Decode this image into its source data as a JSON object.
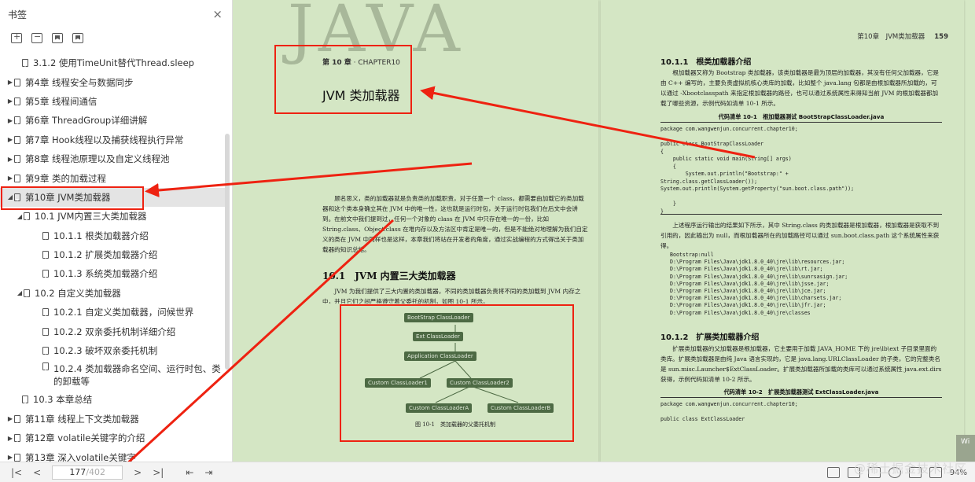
{
  "sidebar": {
    "title": "书签",
    "close": "×",
    "toc": [
      {
        "label": "3.1.2 使用TimeUnit替代Thread.sleep",
        "level": 1,
        "arrow": ""
      },
      {
        "label": "第4章 线程安全与数据同步",
        "level": 0,
        "arrow": "▶"
      },
      {
        "label": "第5章 线程间通信",
        "level": 0,
        "arrow": "▶"
      },
      {
        "label": "第6章 ThreadGroup详细讲解",
        "level": 0,
        "arrow": "▶"
      },
      {
        "label": "第7章 Hook线程以及捕获线程执行异常",
        "level": 0,
        "arrow": "▶"
      },
      {
        "label": "第8章 线程池原理以及自定义线程池",
        "level": 0,
        "arrow": "▶"
      },
      {
        "label": "第9章 类的加载过程",
        "level": 0,
        "arrow": "▶"
      },
      {
        "label": "第10章 JVM类加载器",
        "level": 0,
        "arrow": "◢",
        "selected": true
      },
      {
        "label": "10.1 JVM内置三大类加载器",
        "level": 1,
        "arrow": "◢"
      },
      {
        "label": "10.1.1 根类加载器介绍",
        "level": 2,
        "arrow": ""
      },
      {
        "label": "10.1.2 扩展类加载器介绍",
        "level": 2,
        "arrow": ""
      },
      {
        "label": "10.1.3 系统类加载器介绍",
        "level": 2,
        "arrow": ""
      },
      {
        "label": "10.2 自定义类加载器",
        "level": 1,
        "arrow": "◢"
      },
      {
        "label": "10.2.1 自定义类加载器，问候世界",
        "level": 2,
        "arrow": ""
      },
      {
        "label": "10.2.2 双亲委托机制详细介绍",
        "level": 2,
        "arrow": ""
      },
      {
        "label": "10.2.3 破坏双亲委托机制",
        "level": 2,
        "arrow": ""
      },
      {
        "label": "10.2.4 类加载器命名空间、运行时包、类的卸载等",
        "level": 2,
        "arrow": "",
        "two_line": true
      },
      {
        "label": "10.3 本章总结",
        "level": 1,
        "arrow": ""
      },
      {
        "label": "第11章 线程上下文类加载器",
        "level": 0,
        "arrow": "▶"
      },
      {
        "label": "第12章 volatile关键字的介绍",
        "level": 0,
        "arrow": "▶"
      },
      {
        "label": "第13章 深入volatile关键字",
        "level": 0,
        "arrow": "▶"
      }
    ]
  },
  "left_page": {
    "watermark": "JAVA",
    "chapter_label_bold": "第 10 章",
    "chapter_label_rest": " · CHAPTER10",
    "chapter_title": "JVM 类加载器",
    "intro": "顾名思义，类的加载器就是负责类的加载职责，对于任意一个 class，都需要由加载它的类加载器和这个类本身确立其在 JVM 中的唯一性，这也就是运行时包，关于运行时包我们在后文中会讲到。在前文中我们提到过，任何一个对象的 class 在 JVM 中只存在唯一的一份，比如 String.class、Object.class 在堆内存以及方法区中肯定是唯一的，但是不能绝对地理解为我们自定义的类在 JVM 中同样也是这样，本章我们将站在开发者的角度，通过实战编程的方式得出关于类加载器的知识总结。",
    "section_heading": "10.1　JVM 内置三大类加载器",
    "section_text": "JVM 为我们提供了三大内置的类加载器，不同的类加载器负责将不同的类加载到 JVM 内存之中，并且它们之间严格遵守着父委托的机制，如图 10-1 所示。",
    "diagram_nodes": [
      "BootStrap ClassLoader",
      "Ext ClassLoader",
      "Application ClassLoader",
      "Custom ClassLoader1",
      "Custom ClassLoader2",
      "Custom ClassLoaderA",
      "Custom ClassLoaderB"
    ],
    "figure_caption": "图 10-1　类加载器的父委托机制"
  },
  "right_page": {
    "running_head": "第10章　JVM类加载器",
    "page_number": "159",
    "h1": "10.1.1　根类加载器介绍",
    "p1": "根加载器又称为 Bootstrap 类加载器，该类加载器是最为顶层的加载器，其没有任何父加载器，它是由 C++ 编写的，主要负责虚拟机核心类库的加载，比如整个 java.lang 包都是由根加载器所加载的，可以通过 -Xbootclasspath 来指定根加载器的路径，也可以通过系统属性来得知当前 JVM 的根加载器都加载了哪些资源，示例代码如清单 10-1 所示。",
    "listing1_caption": "代码清单 10-1　根加载器测试 BootStrapClassLoader.java",
    "code1": "package com.wangwenjun.concurrent.chapter10;\n\npublic class BootStrapClassLoader\n{\n    public static void main(String[] args)\n    {\n        System.out.println(\"Bootstrap:\" +\nString.class.getClassLoader());\nSystem.out.println(System.getProperty(\"sun.boot.class.path\"));\n\n    }\n}",
    "p2": "上述程序运行输出的结果如下所示，其中 String.class 的类加载器是根加载器，根加载器是获取不到引用的，因此输出为 null，而根加载器所在的加载路径可以通过 sun.boot.class.path 这个系统属性来获得。",
    "output": "Bootstrap:null\nD:\\Program Files\\Java\\jdk1.8.0_40\\jre\\lib\\resources.jar;\nD:\\Program Files\\Java\\jdk1.8.0_40\\jre\\lib\\rt.jar;\nD:\\Program Files\\Java\\jdk1.8.0_40\\jre\\lib\\sunrsasign.jar;\nD:\\Program Files\\Java\\jdk1.8.0_40\\jre\\lib\\jsse.jar;\nD:\\Program Files\\Java\\jdk1.8.0_40\\jre\\lib\\jce.jar;\nD:\\Program Files\\Java\\jdk1.8.0_40\\jre\\lib\\charsets.jar;\nD:\\Program Files\\Java\\jdk1.8.0_40\\jre\\lib\\jfr.jar;\nD:\\Program Files\\Java\\jdk1.8.0_40\\jre\\classes",
    "h2": "10.1.2　扩展类加载器介绍",
    "p3": "扩展类加载器的父加载器是根加载器，它主要用于加载 JAVA_HOME 下的 jre\\lb\\ext 子目录里面的类库。扩展类加载器是由纯 Java 语言实现的，它是 java.lang.URLClassLoader 的子类，它的完整类名是 sun.misc.Launcher$ExtClassLoader。扩展类加载器所加载的类库可以通过系统属性 java.ext.dirs 获得，示例代码如清单 10-2 所示。",
    "listing2_caption": "代码清单 10-2　扩展类加载器测试 ExtClassLoader.java",
    "code2": "package com.wangwenjun.concurrent.chapter10;\n\npublic class ExtClassLoader"
  },
  "fab_label": "Wi",
  "bottombar": {
    "current_page": "177",
    "total_pages": "/402",
    "zoom": "94%",
    "brand": "@稀土掘金技术社区"
  },
  "colors": {
    "annotation": "#e21",
    "page_bg": "#d4e6c4",
    "diagram_node": "#4d6a44"
  }
}
